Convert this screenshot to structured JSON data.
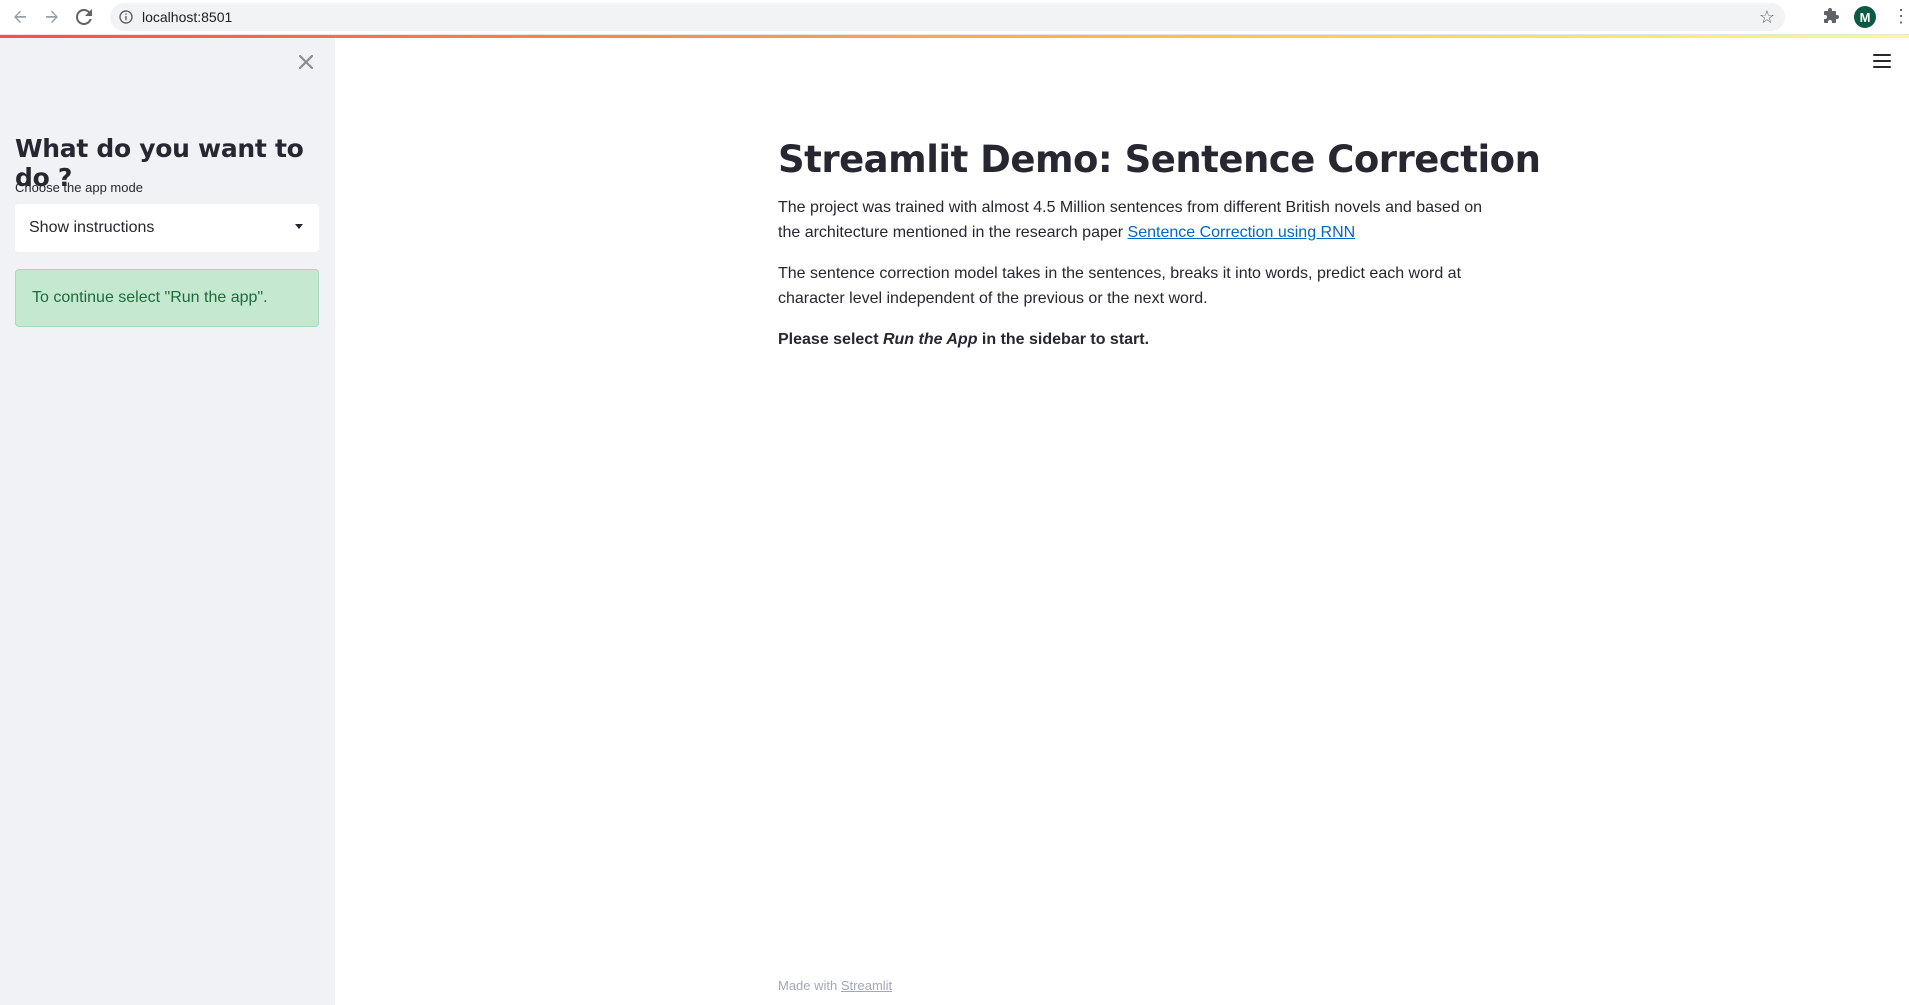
{
  "browser": {
    "url": "localhost:8501",
    "profile_initial": "M"
  },
  "sidebar": {
    "heading": "What do you want to do ?",
    "select_label": "Choose the app mode",
    "select_value": "Show instructions",
    "alert_text": "To continue select \"Run the app\"."
  },
  "main": {
    "title": "Streamlit Demo: Sentence Correction",
    "para1_text": "The project was trained with almost 4.5 Million sentences from different British novels and based on the architecture mentioned in the research paper ",
    "para1_link": "Sentence Correction using RNN",
    "para2_text": "The sentence correction model takes in the sentences, breaks it into words, predict each word at character level independent of the previous or the next word.",
    "para3_prefix": "Please select ",
    "para3_emph": "Run the App",
    "para3_suffix": " in the sidebar to start."
  },
  "footer": {
    "prefix": "Made with ",
    "link": "Streamlit"
  },
  "colors": {
    "sidebar_bg": "#f0f2f6",
    "alert_bg": "#c5e8d1",
    "link": "#0068c9",
    "avatar_bg": "#0b5a46"
  }
}
